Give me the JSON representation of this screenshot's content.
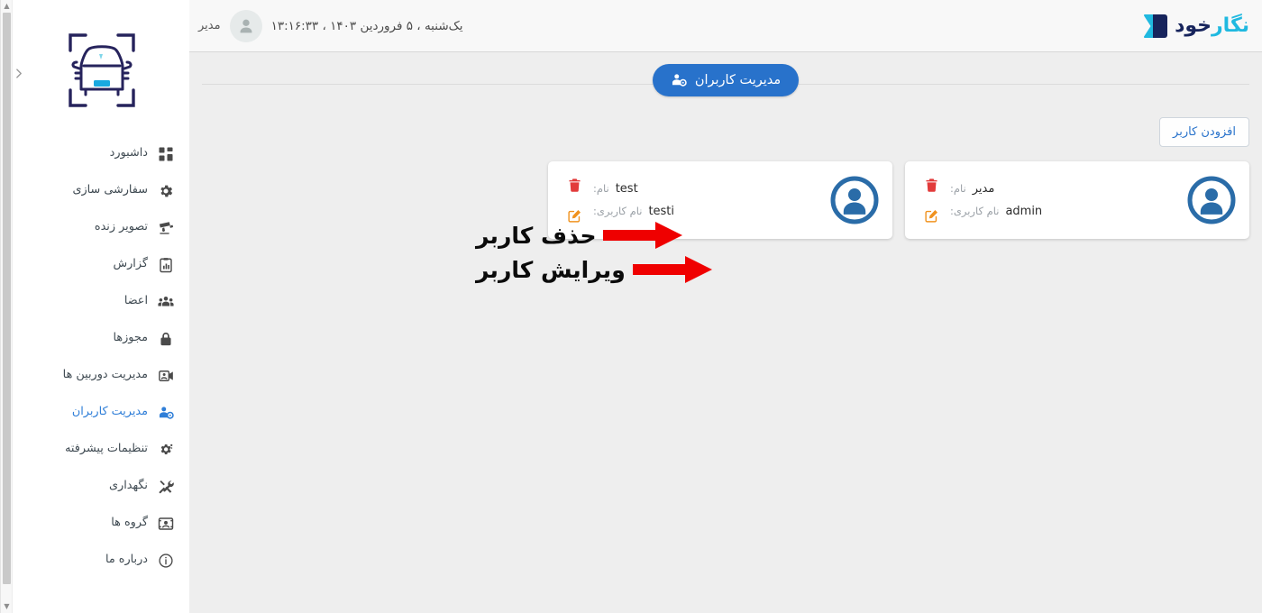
{
  "app": {
    "logo_text_dark": "خود",
    "logo_text_cyan": "نگار",
    "logo_mark_icon": "chevron-logo-icon",
    "accent_color": "#2872cb",
    "brand_dark": "#17245c",
    "brand_cyan": "#20b9e0",
    "delete_color": "#e23b3b",
    "edit_color": "#f0921e"
  },
  "topbar": {
    "datetime": "یک‌شنبه ، ۵ فروردین ۱۴۰۳ ، ۱۳:۱۶:۳۳",
    "user_name": "مدیر",
    "avatar_icon": "user-avatar-icon"
  },
  "page": {
    "title": "مدیریت کاربران",
    "title_icon": "users-gear-icon",
    "add_user_label": "افزودن کاربر"
  },
  "cards": [
    {
      "name_label": "نام:",
      "name_value": "مدیر",
      "username_label": "نام کاربری:",
      "username_value": "admin",
      "avatar_icon": "user-circle-icon",
      "delete_icon": "trash-icon",
      "edit_icon": "edit-square-icon"
    },
    {
      "name_label": "نام:",
      "name_value": "test",
      "username_label": "نام کاربری:",
      "username_value": "testi",
      "avatar_icon": "user-circle-icon",
      "delete_icon": "trash-icon",
      "edit_icon": "edit-square-icon"
    }
  ],
  "annotations": [
    {
      "text": "حذف کاربر",
      "arrow": "red-right-arrow"
    },
    {
      "text": "ویرایش کاربر",
      "arrow": "red-right-arrow"
    }
  ],
  "sidebar": {
    "brand_icon": "car-scan-icon",
    "collapse_icon": "chevron-right-icon",
    "items": [
      {
        "label": "داشبورد",
        "icon": "dashboard-grid-icon",
        "active": false
      },
      {
        "label": "سفارشی سازی",
        "icon": "gear-icon",
        "active": false
      },
      {
        "label": "تصویر زنده",
        "icon": "cctv-camera-icon",
        "active": false
      },
      {
        "label": "گزارش",
        "icon": "clipboard-chart-icon",
        "active": false
      },
      {
        "label": "اعضا",
        "icon": "people-group-icon",
        "active": false
      },
      {
        "label": "مجوزها",
        "icon": "lock-icon",
        "active": false
      },
      {
        "label": "مدیریت دوربین ها",
        "icon": "camera-manage-icon",
        "active": false
      },
      {
        "label": "مدیریت کاربران",
        "icon": "users-gear-icon",
        "active": true
      },
      {
        "label": "تنظیمات پیشرفته",
        "icon": "gear-advanced-icon",
        "active": false
      },
      {
        "label": "نگهداری",
        "icon": "tools-icon",
        "active": false
      },
      {
        "label": "گروه ها",
        "icon": "groups-frame-icon",
        "active": false
      },
      {
        "label": "درباره ما",
        "icon": "info-circle-icon",
        "active": false
      }
    ]
  }
}
